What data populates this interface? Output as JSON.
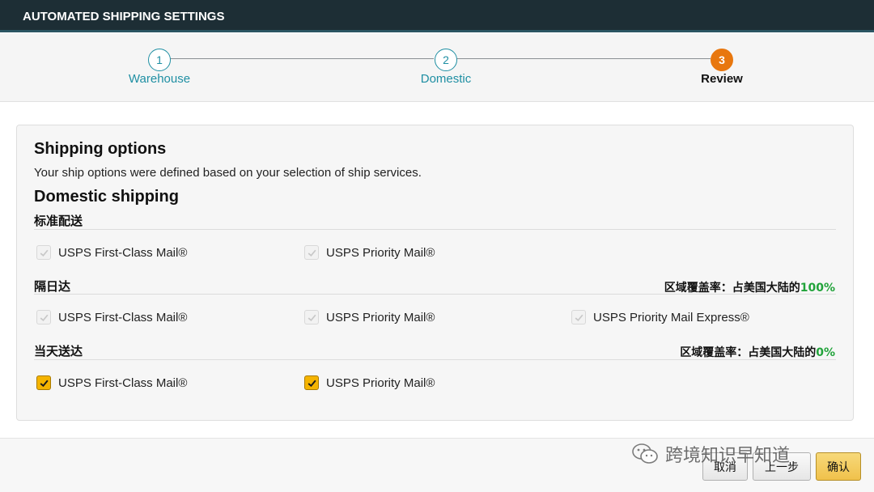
{
  "window": {
    "title": "AUTOMATED SHIPPING SETTINGS"
  },
  "stepper": {
    "steps": [
      {
        "number": "1",
        "label": "Warehouse"
      },
      {
        "number": "2",
        "label": "Domestic"
      },
      {
        "number": "3",
        "label": "Review"
      }
    ],
    "active_step": 3
  },
  "main": {
    "heading": "Shipping options",
    "description": "Your ship options were defined based on your selection of ship services.",
    "subheading": "Domestic shipping",
    "sections": [
      {
        "title": "标准配送",
        "coverage_label": "",
        "coverage_value": "",
        "options": [
          {
            "label": "USPS First-Class Mail®",
            "state": "disabled-checked"
          },
          {
            "label": "USPS Priority Mail®",
            "state": "disabled-checked"
          }
        ]
      },
      {
        "title": "隔日达",
        "coverage_label": "区域覆盖率：占美国大陆的",
        "coverage_value": "100%",
        "options": [
          {
            "label": "USPS First-Class Mail®",
            "state": "disabled-checked"
          },
          {
            "label": "USPS Priority Mail®",
            "state": "disabled-checked"
          },
          {
            "label": "USPS Priority Mail Express®",
            "state": "disabled-checked"
          }
        ]
      },
      {
        "title": "当天送达",
        "coverage_label": "区域覆盖率：占美国大陆的",
        "coverage_value": "0%",
        "options": [
          {
            "label": "USPS First-Class Mail®",
            "state": "checked"
          },
          {
            "label": "USPS Priority Mail®",
            "state": "checked"
          }
        ]
      }
    ]
  },
  "footer": {
    "cancel_label": "取消",
    "back_label": "上一步",
    "confirm_label": "确认"
  },
  "watermark": {
    "text": "跨境知识早知道",
    "icon": "wechat-icon"
  },
  "colors": {
    "title_bar": "#1d2e35",
    "step_accent": "#1f8fa3",
    "active_step": "#e8770e",
    "checkbox_checked": "#f5b400",
    "coverage_pct": "#21a33a"
  }
}
